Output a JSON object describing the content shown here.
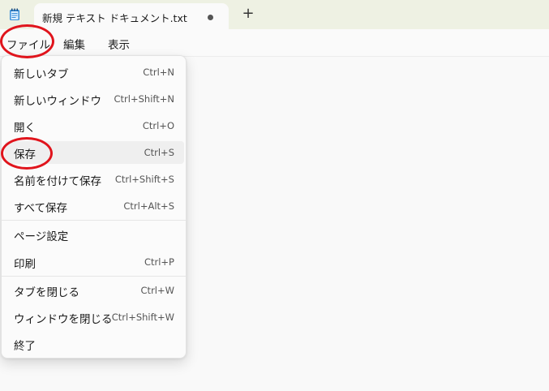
{
  "tab": {
    "title": "新規 テキスト ドキュメント.txt",
    "new_tab_label": "+"
  },
  "menubar": {
    "file": "ファイル",
    "edit": "編集",
    "view": "表示"
  },
  "menu": {
    "items": [
      {
        "label": "新しいタブ",
        "shortcut": "Ctrl+N"
      },
      {
        "label": "新しいウィンドウ",
        "shortcut": "Ctrl+Shift+N"
      },
      {
        "label": "開く",
        "shortcut": "Ctrl+O"
      },
      {
        "label": "保存",
        "shortcut": "Ctrl+S"
      },
      {
        "label": "名前を付けて保存",
        "shortcut": "Ctrl+Shift+S"
      },
      {
        "label": "すべて保存",
        "shortcut": "Ctrl+Alt+S"
      },
      {
        "label": "ページ設定",
        "shortcut": ""
      },
      {
        "label": "印刷",
        "shortcut": "Ctrl+P"
      },
      {
        "label": "タブを閉じる",
        "shortcut": "Ctrl+W"
      },
      {
        "label": "ウィンドウを閉じる",
        "shortcut": "Ctrl+Shift+W"
      },
      {
        "label": "終了",
        "shortcut": ""
      }
    ]
  },
  "colors": {
    "annotation": "#e0141c",
    "titlebar_bg": "#eef1e3"
  },
  "icons": {
    "app": "notepad-icon",
    "unsaved": "unsaved-dot-icon"
  }
}
